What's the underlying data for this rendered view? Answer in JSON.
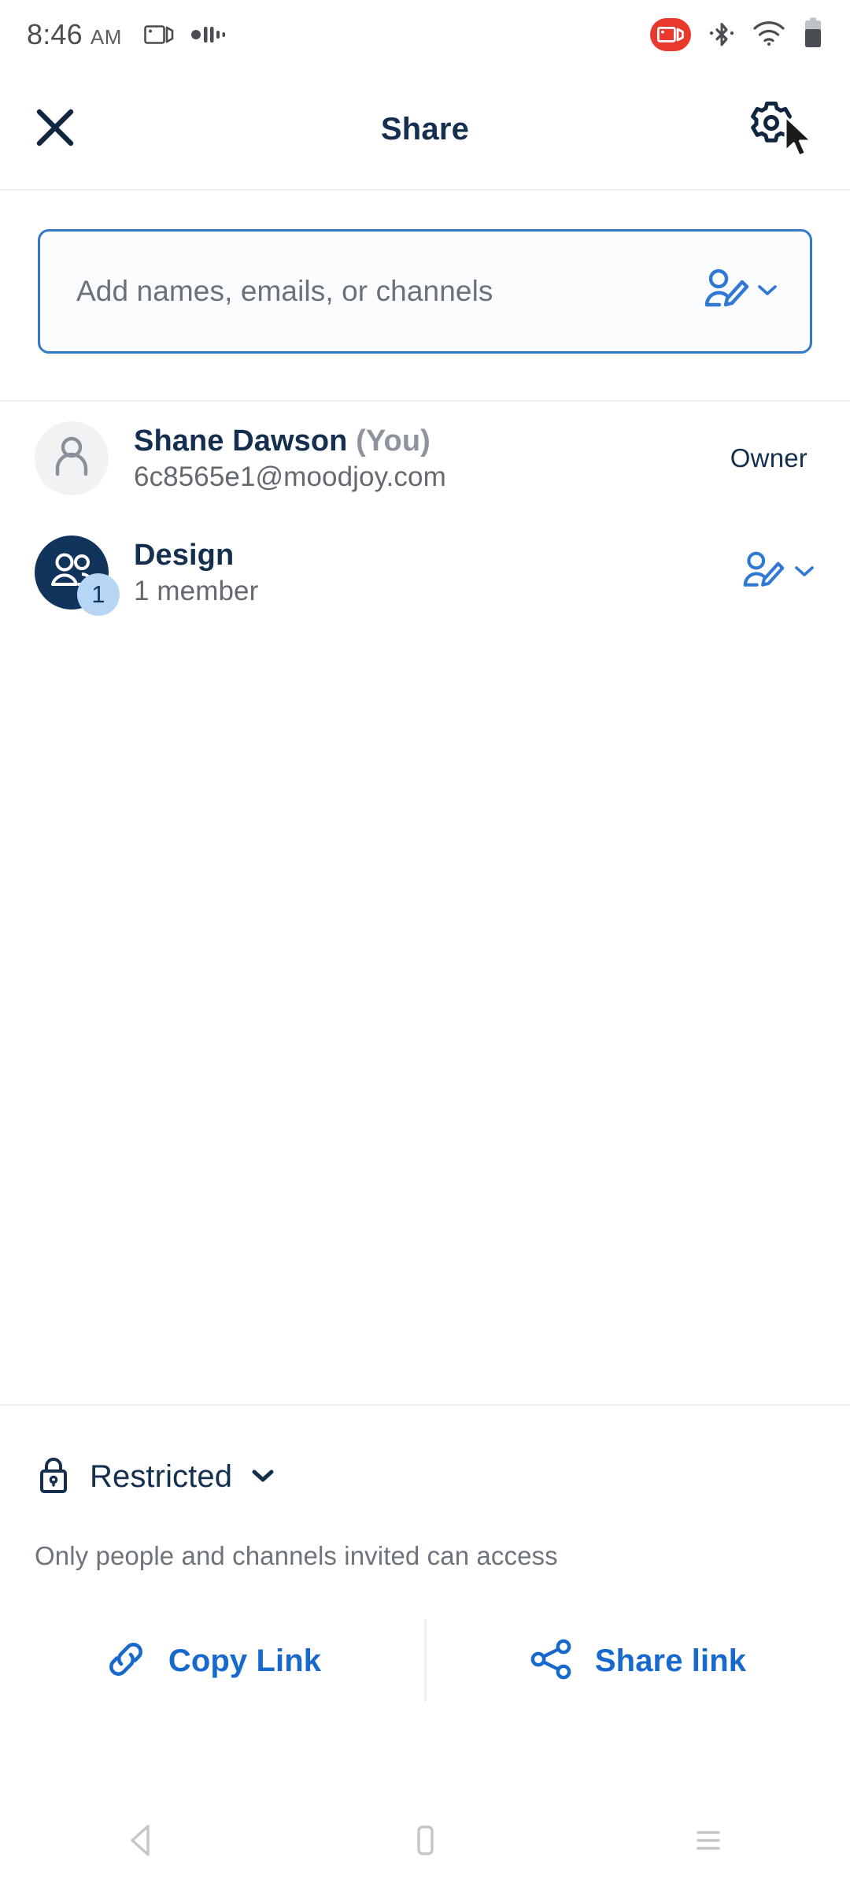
{
  "status_bar": {
    "time": "8:46",
    "ampm": "AM",
    "icons_left": [
      "screen-record-icon",
      "audio-levels-icon"
    ],
    "icons_right": [
      "screen-recording-badge-icon",
      "bluetooth-icon",
      "wifi-icon",
      "battery-icon"
    ],
    "recording_badge_color": "#e8392c",
    "time_color": "#4a4e52"
  },
  "header": {
    "title": "Share",
    "close_icon": "close-icon",
    "settings_icon": "gear-icon",
    "title_color": "#15304f"
  },
  "search": {
    "placeholder": "Add names, emails, or channels",
    "value": "",
    "permission_icon": "person-edit-icon",
    "chevron_icon": "chevron-down-icon",
    "border_color": "#3478c8"
  },
  "people": [
    {
      "name": "Shane Dawson",
      "suffix": "(You)",
      "subtitle": "6c8565e1@moodjoy.com",
      "role": "Owner",
      "avatar_icon": "person-icon",
      "avatar_type": "gray",
      "badge": null,
      "has_permission_control": false
    },
    {
      "name": "Design",
      "suffix": "",
      "subtitle": "1 member",
      "role": "",
      "avatar_icon": "group-icon",
      "avatar_type": "navy",
      "badge": "1",
      "has_permission_control": true,
      "permission_icon": "person-edit-icon",
      "chevron_icon": "chevron-down-icon"
    }
  ],
  "access": {
    "label": "Restricted",
    "lock_icon": "lock-icon",
    "chevron_icon": "chevron-down-icon",
    "description": "Only people and channels invited can access"
  },
  "actions": {
    "copy_link_label": "Copy Link",
    "copy_link_icon": "link-icon",
    "share_link_label": "Share link",
    "share_link_icon": "share-nodes-icon",
    "accent_color": "#1869cd"
  },
  "navigation_bar": {
    "back_icon": "back-triangle-icon",
    "home_icon": "home-square-icon",
    "recents_icon": "recents-menu-icon"
  }
}
